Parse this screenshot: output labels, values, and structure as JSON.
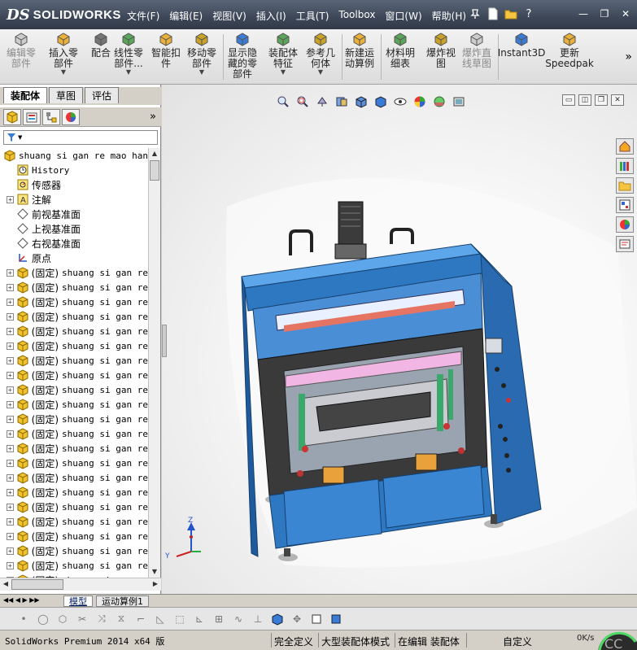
{
  "app": {
    "logo_ds": "DS",
    "logo_text": "SOLIDWORKS"
  },
  "menu": [
    "文件(F)",
    "编辑(E)",
    "视图(V)",
    "插入(I)",
    "工具(T)",
    "Toolbox",
    "窗口(W)",
    "帮助(H)"
  ],
  "commands": [
    {
      "line1": "编辑零",
      "line2": "部件",
      "disabled": true,
      "has_arrow": false
    },
    {
      "line1": "插入零",
      "line2": "部件",
      "disabled": false,
      "has_arrow": true
    },
    {
      "line1": "配合",
      "line2": "",
      "disabled": false,
      "has_arrow": false
    },
    {
      "line1": "线性零",
      "line2": "部件...",
      "disabled": false,
      "has_arrow": true
    },
    {
      "line1": "智能扣",
      "line2": "件",
      "disabled": false,
      "has_arrow": false
    },
    {
      "line1": "移动零",
      "line2": "部件",
      "disabled": false,
      "has_arrow": true
    },
    {
      "line1": "显示隐",
      "line2": "藏的零",
      "line3": "部件",
      "disabled": false,
      "has_arrow": false
    },
    {
      "line1": "装配体",
      "line2": "特征",
      "disabled": false,
      "has_arrow": true
    },
    {
      "line1": "参考几",
      "line2": "何体",
      "disabled": false,
      "has_arrow": true
    },
    {
      "line1": "新建运",
      "line2": "动算例",
      "disabled": false,
      "has_arrow": false
    },
    {
      "line1": "材料明",
      "line2": "细表",
      "disabled": false,
      "has_arrow": false
    },
    {
      "line1": "爆炸视",
      "line2": "图",
      "disabled": false,
      "has_arrow": false
    },
    {
      "line1": "爆炸直",
      "line2": "线草图",
      "disabled": true,
      "has_arrow": false
    },
    {
      "line1": "Instant3D",
      "line2": "",
      "disabled": false,
      "has_arrow": false
    },
    {
      "line1": "更新",
      "line2": "Speedpak",
      "disabled": false,
      "has_arrow": false
    }
  ],
  "panel_tabs": [
    "装配体",
    "草图",
    "评估"
  ],
  "tree": {
    "root": "shuang si gan re mao han j",
    "items": [
      {
        "label": "History",
        "icon": "history-icon",
        "expand": false
      },
      {
        "label": "传感器",
        "icon": "sensor-icon",
        "expand": false
      },
      {
        "label": "注解",
        "icon": "annotation-icon",
        "expand": true
      },
      {
        "label": "前视基准面",
        "icon": "plane-icon",
        "expand": false
      },
      {
        "label": "上视基准面",
        "icon": "plane-icon",
        "expand": false
      },
      {
        "label": "右视基准面",
        "icon": "plane-icon",
        "expand": false
      },
      {
        "label": "原点",
        "icon": "origin-icon",
        "expand": false
      }
    ],
    "component_prefix": "(固定)",
    "component_name": "shuang si gan re",
    "component_count": 22
  },
  "graphics": {
    "triad_y": "Y",
    "triad_z": "Z"
  },
  "bottom_tabs": [
    "模型",
    "运动算例1"
  ],
  "status": {
    "product": "SolidWorks Premium 2014 x64 版",
    "defined": "完全定义",
    "mode": "大型装配体模式",
    "editing": "在编辑 装配体",
    "custom": "自定义",
    "net": "0K/s"
  },
  "colors": {
    "title_bg": "#3d4757",
    "machine_blue": "#2e78c2",
    "frame_dark": "#3a3a3a"
  }
}
